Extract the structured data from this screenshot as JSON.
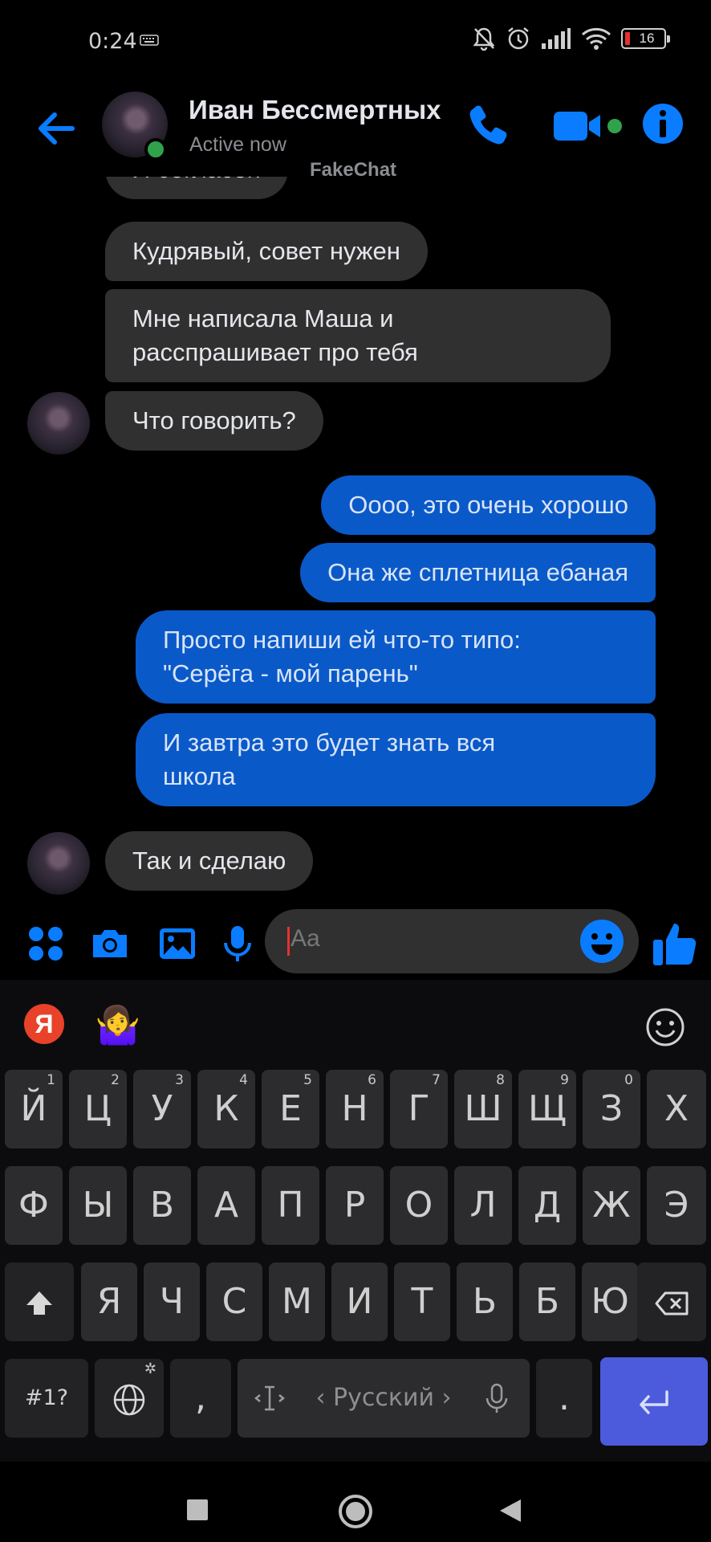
{
  "status_bar": {
    "time": "0:24",
    "battery_level": "16",
    "icons": [
      "keyboard-icon",
      "bell-off-icon",
      "alarm-icon",
      "signal-icon",
      "wifi-icon",
      "battery-icon"
    ]
  },
  "header": {
    "contact_name": "Иван Бессмертных",
    "contact_status": "Active now",
    "watermark": "FakeChat",
    "icons": [
      "back-arrow-icon",
      "phone-icon",
      "video-camera-icon",
      "info-icon"
    ],
    "accent_color": "#0a7cff"
  },
  "messages": [
    {
      "from": "contact",
      "text": "Я согласен"
    },
    {
      "from": "contact",
      "text": "Кудрявый, совет нужен"
    },
    {
      "from": "contact",
      "lines": [
        "Мне написала Маша и",
        "расспрашивает про тебя"
      ]
    },
    {
      "from": "contact",
      "text": "Что говорить?"
    },
    {
      "from": "me",
      "text": "Оооо, это очень хорошо"
    },
    {
      "from": "me",
      "text": "Она же сплетница ебаная"
    },
    {
      "from": "me",
      "lines": [
        "Просто напиши ей что-то типо:",
        "\"Серёга - мой парень\""
      ]
    },
    {
      "from": "me",
      "lines": [
        "И завтра это будет знать вся",
        "школа"
      ]
    },
    {
      "from": "contact",
      "text": "Так и сделаю"
    }
  ],
  "composer": {
    "placeholder": "Aa",
    "icons": [
      "apps-icon",
      "camera-icon",
      "gallery-icon",
      "microphone-icon",
      "emoji-icon",
      "thumbs-up-icon"
    ]
  },
  "keyboard": {
    "toolbar_icons": [
      "yandex-icon",
      "shrug-emoji-icon",
      "smiley-icon"
    ],
    "yandex_label": "Я",
    "shrug_glyph": "🤷‍♀️",
    "row1": [
      "Й",
      "Ц",
      "У",
      "К",
      "Е",
      "Н",
      "Г",
      "Ш",
      "Щ",
      "З",
      "Х"
    ],
    "row1_hints": [
      "1",
      "2",
      "3",
      "4",
      "5",
      "6",
      "7",
      "8",
      "9",
      "0",
      ""
    ],
    "row2": [
      "Ф",
      "Ы",
      "В",
      "А",
      "П",
      "Р",
      "О",
      "Л",
      "Д",
      "Ж",
      "Э"
    ],
    "row3": [
      "Я",
      "Ч",
      "С",
      "М",
      "И",
      "Т",
      "Ь",
      "Б",
      "Ю"
    ],
    "symbols_label": "#1?",
    "comma_label": ",",
    "period_label": ".",
    "space_label": "‹ Русский ›",
    "row4_icons": [
      "globe-icon",
      "cursor-icon",
      "microphone-icon",
      "enter-icon",
      "shift-icon",
      "backspace-icon"
    ],
    "enter_color": "#4b5bdc"
  },
  "nav_bar": {
    "icons": [
      "recents-square-icon",
      "home-circle-icon",
      "back-triangle-icon"
    ]
  }
}
